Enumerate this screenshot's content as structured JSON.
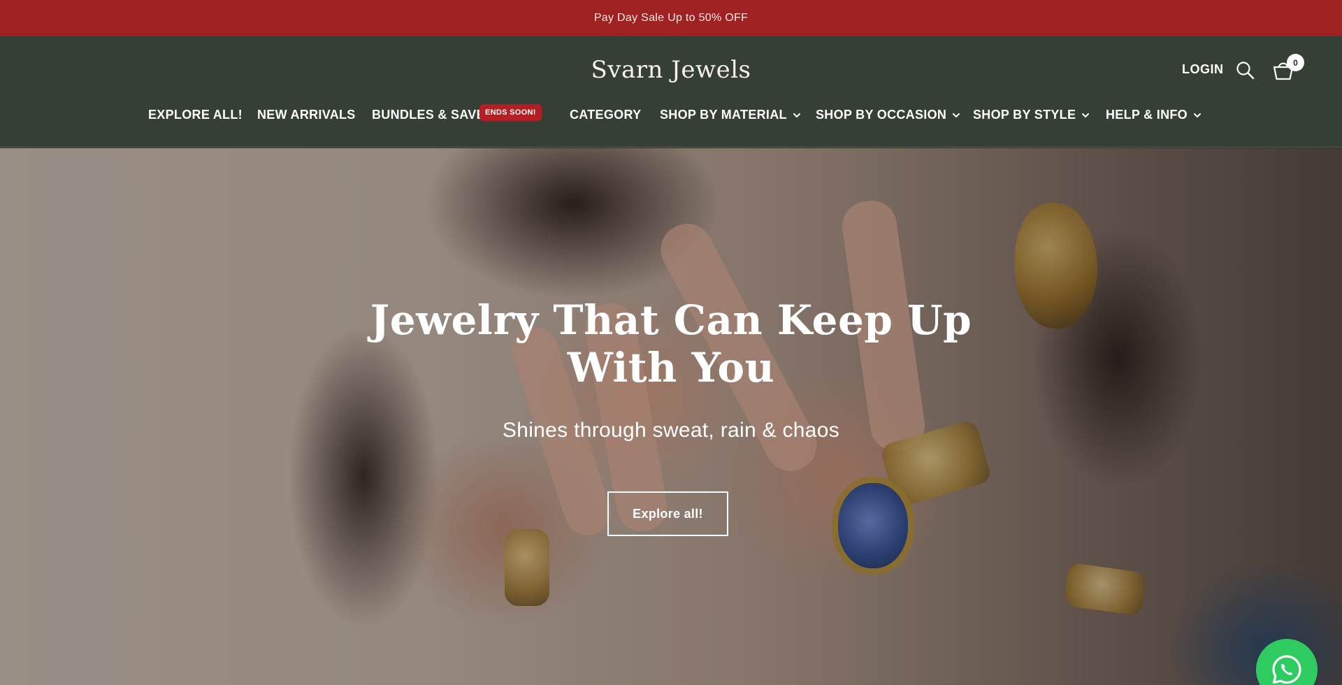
{
  "announcement": {
    "text": "Pay Day Sale Up to 50% OFF"
  },
  "header": {
    "brand": "Svarn Jewels",
    "login_label": "LOGIN",
    "cart_count": "0"
  },
  "nav": {
    "items": [
      {
        "label": "EXPLORE ALL!",
        "has_dropdown": false
      },
      {
        "label": "NEW ARRIVALS",
        "has_dropdown": false
      },
      {
        "label": "BUNDLES & SAVE",
        "has_dropdown": false,
        "badge": "ENDS SOON!"
      },
      {
        "label": "CATEGORY",
        "has_dropdown": false
      },
      {
        "label": "SHOP BY MATERIAL",
        "has_dropdown": true
      },
      {
        "label": "SHOP BY OCCASION",
        "has_dropdown": true
      },
      {
        "label": "SHOP BY STYLE",
        "has_dropdown": true
      },
      {
        "label": "HELP & INFO",
        "has_dropdown": true
      }
    ]
  },
  "hero": {
    "title": "Jewelry That Can Keep Up With You",
    "subtitle": "Shines through sweat, rain & chaos",
    "cta_label": "Explore all!"
  },
  "colors": {
    "announcement_bg": "#9f2121",
    "header_bg": "#363f36",
    "badge_bg": "#b21f24",
    "whatsapp_green": "#2ecb61"
  },
  "icons": {
    "search": "search-icon",
    "cart": "cart-icon",
    "dropdown": "chevron-down-icon",
    "whatsapp": "whatsapp-icon"
  }
}
